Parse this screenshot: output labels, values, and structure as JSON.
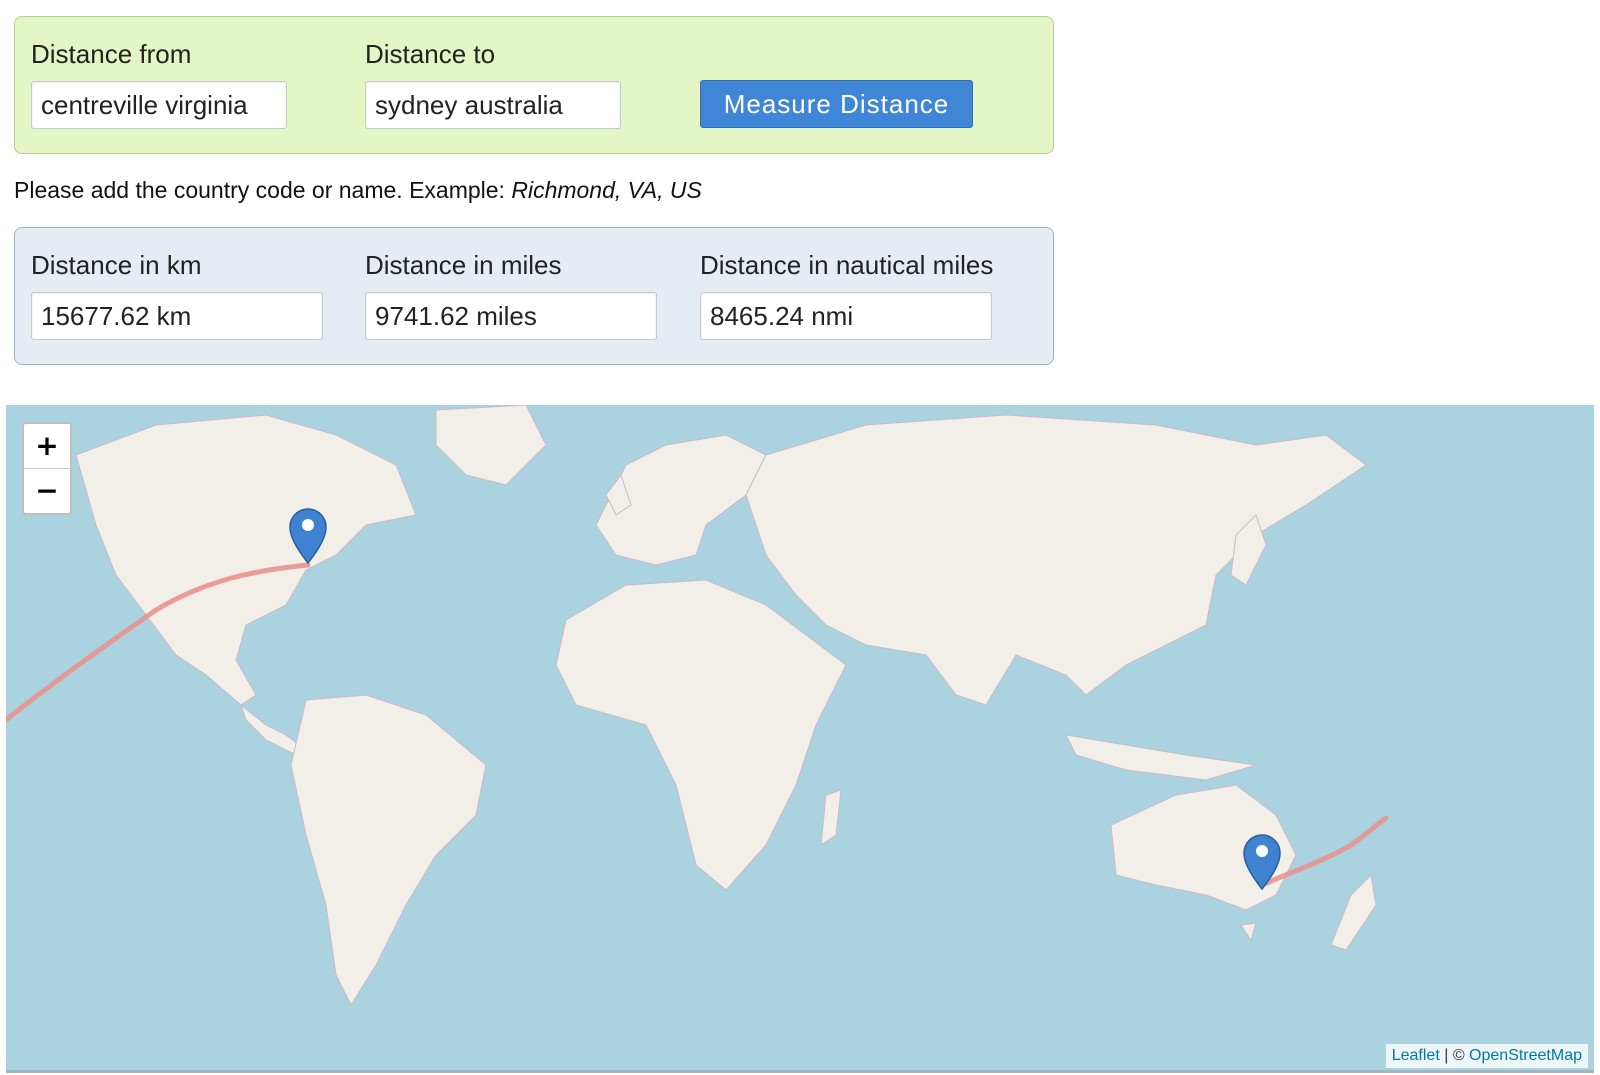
{
  "form": {
    "from_label": "Distance from",
    "from_value": "centreville virginia",
    "to_label": "Distance to",
    "to_value": "sydney australia",
    "measure_button": "Measure Distance"
  },
  "hint": {
    "text": "Please add the country code or name. Example: ",
    "example": "Richmond, VA, US"
  },
  "results": {
    "km_label": "Distance in km",
    "km_value": "15677.62 km",
    "miles_label": "Distance in miles",
    "miles_value": "9741.62 miles",
    "nmi_label": "Distance in nautical miles",
    "nmi_value": "8465.24 nmi"
  },
  "map": {
    "zoom_in": "+",
    "zoom_out": "−",
    "attribution_leaflet": "Leaflet",
    "attribution_separator": " | © ",
    "attribution_osm": "OpenStreetMap",
    "colors": {
      "water": "#aad3df",
      "land": "#f2efe9",
      "route": "#e8928f",
      "marker": "#3f82cf"
    }
  }
}
